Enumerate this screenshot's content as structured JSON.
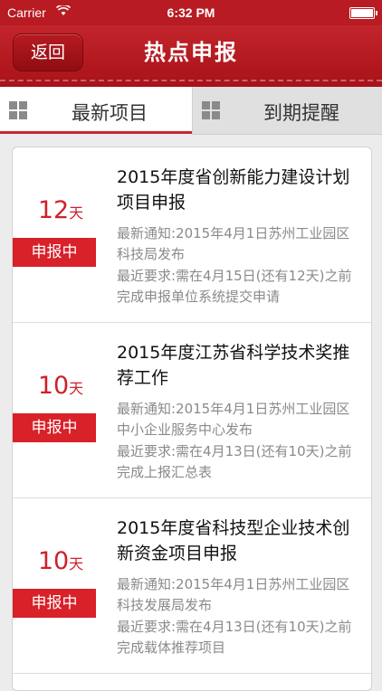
{
  "status_bar": {
    "carrier": "Carrier",
    "time": "6:32 PM",
    "battery_level": 1.0
  },
  "navbar": {
    "back_label": "返回",
    "title": "热点申报",
    "color": "#b81b22"
  },
  "tabs": [
    {
      "label": "最新项目",
      "active": true
    },
    {
      "label": "到期提醒",
      "active": false
    }
  ],
  "items": [
    {
      "days": "12",
      "unit": "天",
      "status": "申报中",
      "title": "2015年度省创新能力建设计划项目申报",
      "notice": "最新通知:2015年4月1日苏州工业园区科技局发布",
      "requirement": "最近要求:需在4月15日(还有12天)之前完成申报单位系统提交申请"
    },
    {
      "days": "10",
      "unit": "天",
      "status": "申报中",
      "title": "2015年度江苏省科学技术奖推荐工作",
      "notice": "最新通知:2015年4月1日苏州工业园区中小企业服务中心发布",
      "requirement": "最近要求:需在4月13日(还有10天)之前完成上报汇总表"
    },
    {
      "days": "10",
      "unit": "天",
      "status": "申报中",
      "title": "2015年度省科技型企业技术创新资金项目申报",
      "notice": "最新通知:2015年4月1日苏州工业园区科技发展局发布",
      "requirement": "最近要求:需在4月13日(还有10天)之前完成载体推荐项目"
    }
  ],
  "colors": {
    "accent": "#d82129",
    "muted_text": "#8a8a8a"
  }
}
